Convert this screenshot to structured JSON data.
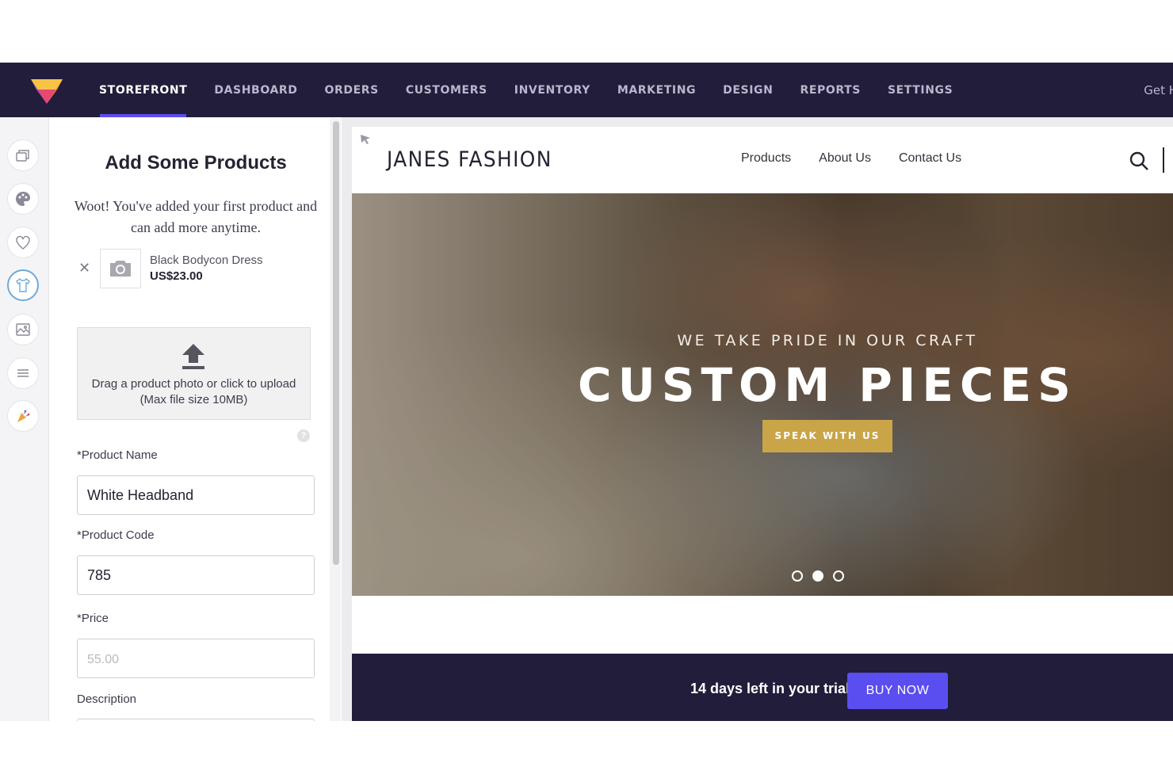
{
  "topnav": {
    "items": [
      {
        "label": "STOREFRONT",
        "active": true
      },
      {
        "label": "DASHBOARD"
      },
      {
        "label": "ORDERS"
      },
      {
        "label": "CUSTOMERS"
      },
      {
        "label": "INVENTORY"
      },
      {
        "label": "MARKETING"
      },
      {
        "label": "DESIGN"
      },
      {
        "label": "REPORTS"
      },
      {
        "label": "SETTINGS"
      }
    ],
    "help_label": "Get H"
  },
  "rail": {
    "icons": [
      "layers-icon",
      "palette-icon",
      "heart-icon",
      "shirt-icon",
      "image-icon",
      "menu-icon",
      "party-icon"
    ],
    "active": "shirt-icon"
  },
  "panel": {
    "title": "Add Some Products",
    "message": "Woot! You've added your first product and can add more anytime.",
    "product": {
      "name": "Black Bodycon Dress",
      "price": "US$23.00"
    },
    "upload_text": "Drag a product photo or click to upload (Max file size 10MB)",
    "fields": {
      "name_label": "*Product Name",
      "name_value": "White Headband",
      "code_label": "*Product Code",
      "code_value": "785",
      "price_label": "*Price",
      "price_placeholder": "55.00",
      "description_label": "Description"
    }
  },
  "preview": {
    "site_name": "JANES FASHION",
    "nav": [
      "Products",
      "About Us",
      "Contact Us"
    ],
    "hero": {
      "subtitle": "WE TAKE PRIDE IN OUR CRAFT",
      "title": "CUSTOM PIECES",
      "button": "SPEAK WITH US",
      "slides": 3,
      "active_slide": 2
    }
  },
  "trial": {
    "text": "14 days left in your trial",
    "button": "BUY NOW"
  },
  "colors": {
    "nav_bg": "#211d3a",
    "accent": "#5b4ef0",
    "hero_button": "#c9a548"
  }
}
